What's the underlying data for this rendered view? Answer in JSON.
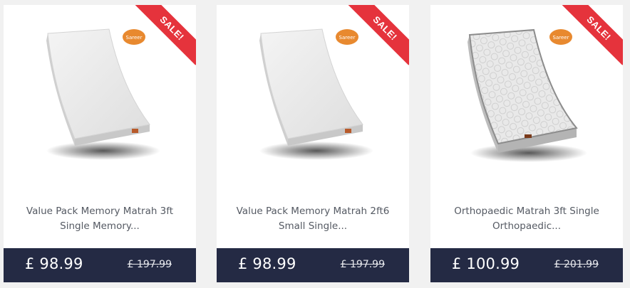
{
  "colors": {
    "page_background": "#f1f1f1",
    "card_background": "#ffffff",
    "price_bar": "#242a44",
    "sale_ribbon": "#e5333c",
    "title_text": "#555a63",
    "brand_badge": "#e8892f"
  },
  "products": [
    {
      "badge": "SALE!",
      "brand_logo": "Sareer",
      "title_line1": "Value Pack Memory Matrah 3ft",
      "title_line2": "Single Memory...",
      "price": "£ 98.99",
      "old_price": "£ 197.99",
      "image_icon": "mattress-plain-image"
    },
    {
      "badge": "SALE!",
      "brand_logo": "Sareer",
      "title_line1": "Value Pack Memory Matrah 2ft6",
      "title_line2": "Small Single...",
      "price": "£ 98.99",
      "old_price": "£ 197.99",
      "image_icon": "mattress-plain-image"
    },
    {
      "badge": "SALE!",
      "brand_logo": "Sareer",
      "title_line1": "Orthopaedic Matrah 3ft Single",
      "title_line2": "Orthopaedic...",
      "price": "£ 100.99",
      "old_price": "£ 201.99",
      "image_icon": "mattress-quilted-image"
    }
  ]
}
